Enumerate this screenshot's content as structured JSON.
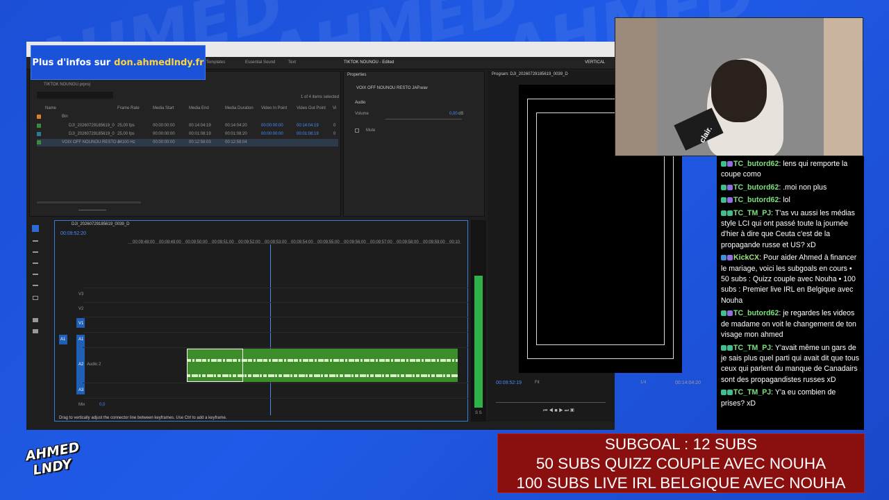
{
  "watermark": "AHMED",
  "promo": {
    "prefix": "Plus d'infos sur",
    "link": "don.ahmedlndy.fr"
  },
  "premiere": {
    "title": "TIKTOK NOUNOU - Edited",
    "tabs": [
      "ics Templates",
      "Essential Sound",
      "Text"
    ],
    "vertical_label": "VERTICAL",
    "project": {
      "name": "TIKTOK NOUNOU.prproj",
      "count": "1 of 4 items selected",
      "headers": [
        "Name",
        "Frame Rate",
        "Media Start",
        "Media End",
        "Media Duration",
        "Video In Point",
        "Video Out Point",
        "Vi"
      ],
      "bin": "Bin",
      "rows": [
        {
          "name": "DJI_20260729185619_0",
          "fps": "25,00 fps",
          "start": "00:00:00:00",
          "end": "00:14:04:19",
          "dur": "00:14:04:20",
          "in": "00:00:00:00",
          "out": "00:14:04:19",
          "v": "0"
        },
        {
          "name": "DJI_20260729185619_0",
          "fps": "25,00 fps",
          "start": "00:00:00:00",
          "end": "00:01:08:19",
          "dur": "00:01:08:20",
          "in": "00:00:00:00",
          "out": "00:01:08:19",
          "v": "0"
        },
        {
          "name": "VOIX OFF NOUNOU RESTO J",
          "fps": "44100 Hz",
          "start": "00:00:00:00",
          "end": "00:12:58:03",
          "dur": "00:12:58:04",
          "in": "",
          "out": "",
          "v": ""
        }
      ]
    },
    "properties": {
      "title": "Properties",
      "file": "VOIX OFF NOUNOU RESTO JAP.wav",
      "audio": "Audio",
      "volume": "Volume",
      "volume_value": "0,00",
      "volume_unit": "dB",
      "mute": "Mute"
    },
    "program": {
      "title": "Program: DJI_20260729185619_0039_D",
      "timecode": "00:09:52:19",
      "fit": "Fit",
      "ratio": "1/4",
      "duration": "00:14:04:20"
    },
    "timeline": {
      "seq": "DJI_20260729185619_0039_D",
      "timecode": "00:09:52:20",
      "ticks": [
        "00:09:48:00",
        "00:09:49:00",
        "00:09:50:00",
        "00:09:51:00",
        "00:09:52:00",
        "00:09:53:00",
        "00:09:54:00",
        "00:09:55:00",
        "00:09:56:00",
        "00:09:57:00",
        "00:09:58:00",
        "00:09:59:00",
        "00:10"
      ],
      "tracks": {
        "v3": "V3",
        "v2": "V2",
        "v1": "V1",
        "a1": "A1",
        "a2": "A2",
        "a2name": "Audio 2",
        "a3": "A3",
        "mix": "Mix",
        "mixval": "0,0"
      },
      "status": "Drag to vertically adjust the connector line between keyframes. Use Ctrl to add a keyframe."
    },
    "meter": "S S"
  },
  "chat": [
    {
      "user": "TC_butord62",
      "text": "lens qui remporte la coupe como"
    },
    {
      "user": "TC_butord62",
      "text": ".moi non plus"
    },
    {
      "user": "TC_butord62",
      "text": "lol"
    },
    {
      "user": "TC_TM_PJ",
      "text": "T'as vu aussi les médias style LCI qui ont passé toute la journée d'hier à dire que Ceuta c'est de la propagande russe et US? xD"
    },
    {
      "user": "KickCX",
      "text": "Pour aider Ahmed à financer le mariage, voici les subgoals en cours • 50 subs : Quizz couple avec Nouha • 100 subs : Premier live IRL en Belgique avec Nouha"
    },
    {
      "user": "TC_butord62",
      "text": "je regardes les videos de madame on voit le changement de ton visage mon ahmed"
    },
    {
      "user": "TC_TM_PJ",
      "text": "Y'avait même un gars de je sais plus quel parti qui avait dit que tous ceux qui parlent du manque de Canadairs sont des propagandistes russes xD"
    },
    {
      "user": "TC_TM_PJ",
      "text": "Y'a eu combien de prises? xD"
    }
  ],
  "subgoal": [
    "SUBGOAL : 12 SUBS",
    "50 SUBS QUIZZ COUPLE AVEC NOUHA",
    "100 SUBS LIVE IRL BELGIQUE AVEC NOUHA"
  ],
  "logo": [
    "AHMED",
    "LNDY"
  ],
  "webcam": {
    "mic_label": "clair."
  }
}
